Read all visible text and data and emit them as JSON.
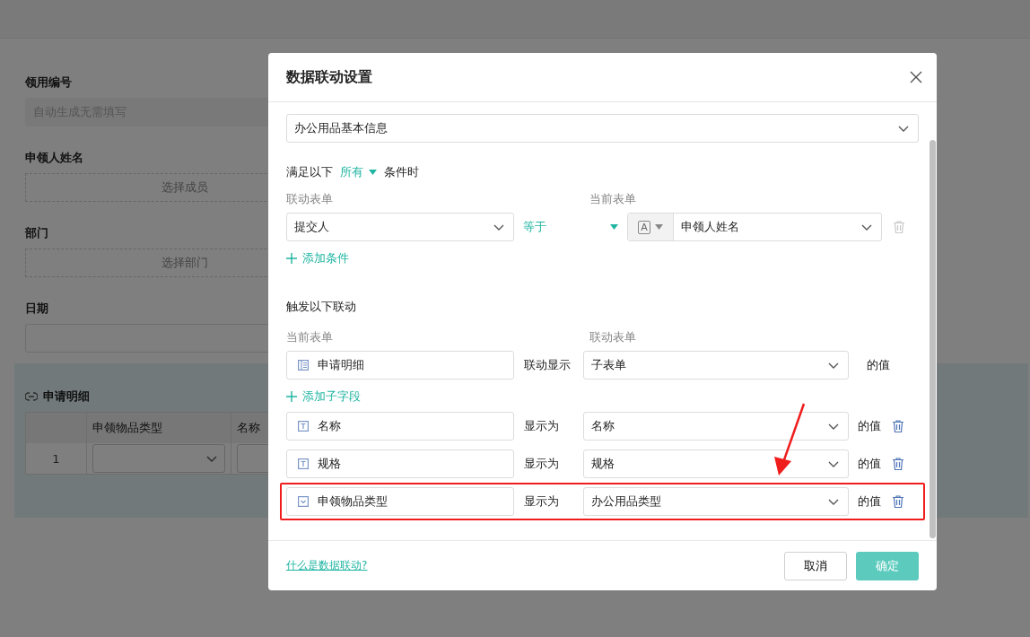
{
  "background_form": {
    "fields": [
      {
        "label": "领用编号",
        "kind": "input",
        "placeholder": "自动生成无需填写",
        "disabled": true
      },
      {
        "label": "申领人姓名",
        "kind": "picker",
        "text": "选择成员"
      },
      {
        "label": "部门",
        "kind": "picker",
        "text": "选择部门"
      },
      {
        "label": "日期",
        "kind": "input"
      }
    ],
    "subform": {
      "title": "申请明细",
      "columns": [
        "申领物品类型",
        "名称"
      ],
      "rows": [
        {
          "index": "1"
        }
      ]
    }
  },
  "dialog": {
    "title": "数据联动设置",
    "source_form": "办公用品基本信息",
    "condition": {
      "prefix": "满足以下",
      "mode": "所有",
      "suffix": "条件时",
      "linked_label": "联动表单",
      "current_label": "当前表单",
      "rows": [
        {
          "field": "提交人",
          "operator": "等于",
          "value_type": "A",
          "value": "申领人姓名"
        }
      ],
      "add": "添加条件"
    },
    "trigger": {
      "title": "触发以下联动",
      "current_label": "当前表单",
      "linked_label": "联动表单",
      "main": {
        "field": "申请明细",
        "verb": "联动显示",
        "target": "子表单",
        "suffix": "的值"
      },
      "add": "添加子字段",
      "rows": [
        {
          "kind": "text",
          "field": "名称",
          "verb": "显示为",
          "target": "名称",
          "suffix": "的值",
          "highlighted": false
        },
        {
          "kind": "text",
          "field": "规格",
          "verb": "显示为",
          "target": "规格",
          "suffix": "的值",
          "highlighted": false
        },
        {
          "kind": "select",
          "field": "申领物品类型",
          "verb": "显示为",
          "target": "办公用品类型",
          "suffix": "的值",
          "highlighted": true
        }
      ]
    },
    "footer": {
      "help_link": "什么是数据联动?",
      "cancel": "取消",
      "confirm": "确定"
    }
  }
}
